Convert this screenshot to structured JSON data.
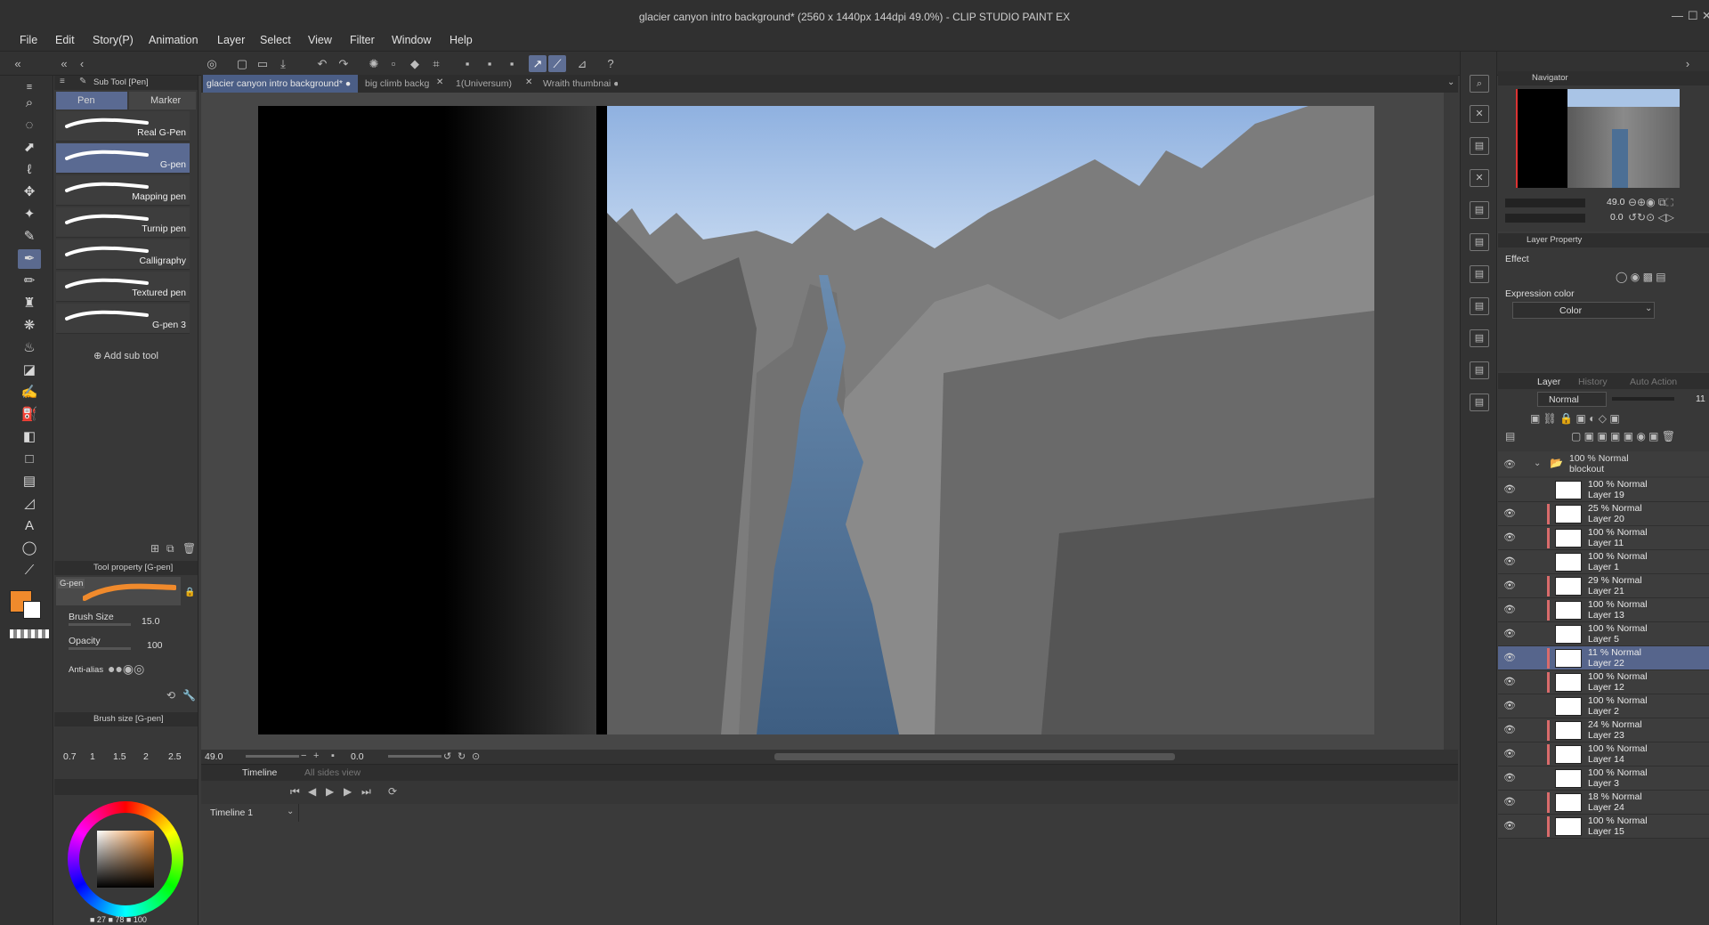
{
  "app": {
    "title": "glacier canyon intro background* (2560 x 1440px 144dpi 49.0%)  - CLIP STUDIO PAINT EX",
    "window_controls": [
      "—",
      "☐",
      "✕"
    ]
  },
  "menu": [
    "File",
    "Edit",
    "Story(P)",
    "Animation",
    "Layer",
    "Select",
    "View",
    "Filter",
    "Window",
    "Help"
  ],
  "subtool_panel": {
    "title": "Sub Tool [Pen]",
    "groups": [
      "Pen",
      "Marker"
    ],
    "brushes": [
      "Real G-Pen",
      "G-pen",
      "Mapping pen",
      "Turnip pen",
      "Calligraphy",
      "Textured pen",
      "G-pen 3"
    ],
    "add_label": "Add sub tool"
  },
  "tool_property": {
    "title": "Tool property [G-pen]",
    "preview_label": "G-pen",
    "brush_size_label": "Brush Size",
    "brush_size_value": "15.0",
    "opacity_label": "Opacity",
    "opacity_value": "100",
    "antialias_label": "Anti-alias"
  },
  "brush_size_panel": {
    "title": "Brush size [G-pen]",
    "sizes": [
      "0.7",
      "1",
      "1.5",
      "2",
      "2.5"
    ]
  },
  "color": {
    "main": "#f08a2c",
    "sub": "#ffffff",
    "readout": "■ 27 ■ 78 ■ 100"
  },
  "documents": {
    "tabs": [
      "glacier canyon intro background*",
      "big climb backg",
      "1(Universum)",
      "Wraith thumbnai"
    ]
  },
  "canvas": {
    "zoom": "49.0",
    "rotation": "0.0"
  },
  "timeline": {
    "tabs": [
      "Timeline",
      "All sides view"
    ],
    "selected": "Timeline 1"
  },
  "navigator": {
    "title": "Navigator",
    "zoom": "49.0",
    "rotation": "0.0"
  },
  "layer_property": {
    "title": "Layer Property",
    "effect_label": "Effect",
    "expression_label": "Expression color",
    "expression_value": "Color"
  },
  "layer_panel": {
    "tabs": [
      "Layer",
      "History",
      "Auto Action"
    ],
    "blend_mode": "Normal",
    "opacity": "11",
    "folder": {
      "mode": "100 % Normal",
      "name": "blockout"
    },
    "layers": [
      {
        "mode": "100 % Normal",
        "name": "Layer 19"
      },
      {
        "mode": "25 % Normal",
        "name": "Layer 20"
      },
      {
        "mode": "100 % Normal",
        "name": "Layer 11"
      },
      {
        "mode": "100 % Normal",
        "name": "Layer 1"
      },
      {
        "mode": "29 % Normal",
        "name": "Layer 21"
      },
      {
        "mode": "100 % Normal",
        "name": "Layer 13"
      },
      {
        "mode": "100 % Normal",
        "name": "Layer 5"
      },
      {
        "mode": "11 % Normal",
        "name": "Layer 22"
      },
      {
        "mode": "100 % Normal",
        "name": "Layer 12"
      },
      {
        "mode": "100 % Normal",
        "name": "Layer 2"
      },
      {
        "mode": "24 % Normal",
        "name": "Layer 23"
      },
      {
        "mode": "100 % Normal",
        "name": "Layer 14"
      },
      {
        "mode": "100 % Normal",
        "name": "Layer 3"
      },
      {
        "mode": "18 % Normal",
        "name": "Layer 24"
      },
      {
        "mode": "100 % Normal",
        "name": "Layer 15"
      }
    ]
  }
}
